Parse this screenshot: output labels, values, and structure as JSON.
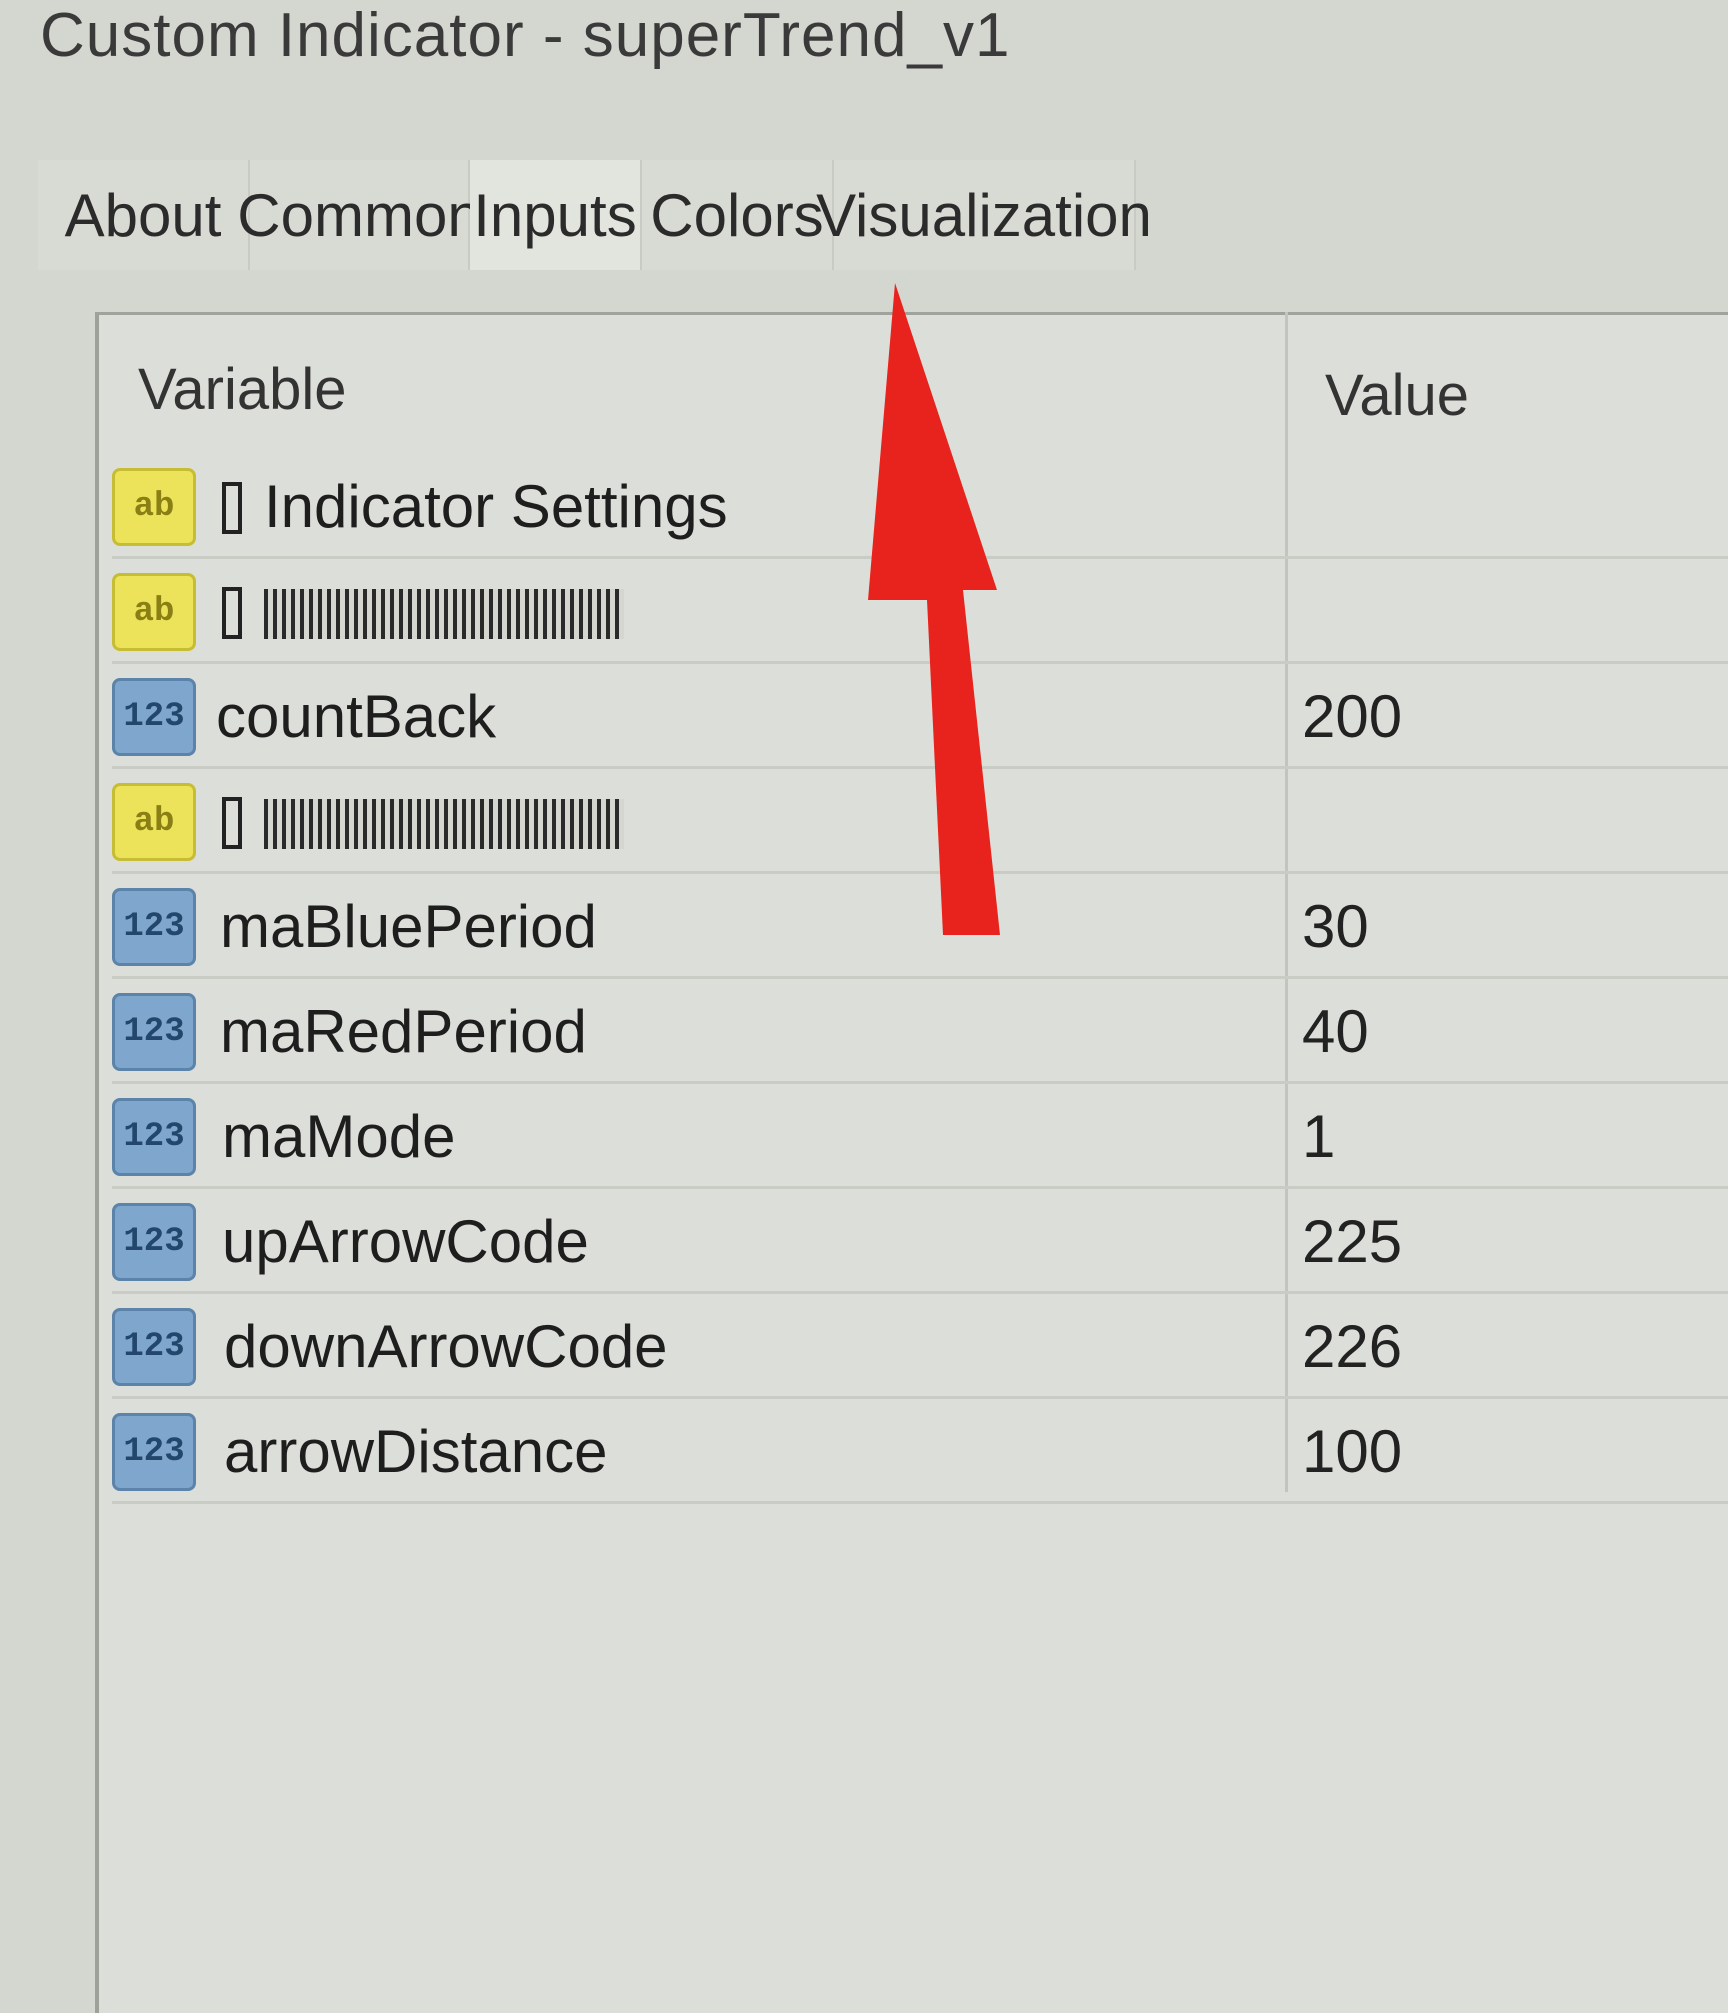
{
  "window": {
    "title": "Custom Indicator - superTrend_v1"
  },
  "tabs": [
    {
      "label": "About"
    },
    {
      "label": "Common"
    },
    {
      "label": "Inputs"
    },
    {
      "label": "Colors"
    },
    {
      "label": "Visualization"
    }
  ],
  "table": {
    "headers": {
      "variable": "Variable",
      "value": "Value"
    },
    "rows": [
      {
        "type": "ab",
        "name": "Indicator Settings",
        "value": ""
      },
      {
        "type": "ab",
        "name": "",
        "value": ""
      },
      {
        "type": "123",
        "name": "countBack",
        "value": "200"
      },
      {
        "type": "ab",
        "name": "",
        "value": ""
      },
      {
        "type": "123",
        "name": "maBluePeriod",
        "value": "30"
      },
      {
        "type": "123",
        "name": "maRedPeriod",
        "value": "40"
      },
      {
        "type": "123",
        "name": "maMode",
        "value": "1"
      },
      {
        "type": "123",
        "name": "upArrowCode",
        "value": "225"
      },
      {
        "type": "123",
        "name": "downArrowCode",
        "value": "226"
      },
      {
        "type": "123",
        "name": "arrowDistance",
        "value": "100"
      }
    ]
  },
  "icons": {
    "string": "ab",
    "number": "123"
  },
  "annotation": {
    "color": "#e8231d",
    "icon": "red-arrow-icon"
  }
}
